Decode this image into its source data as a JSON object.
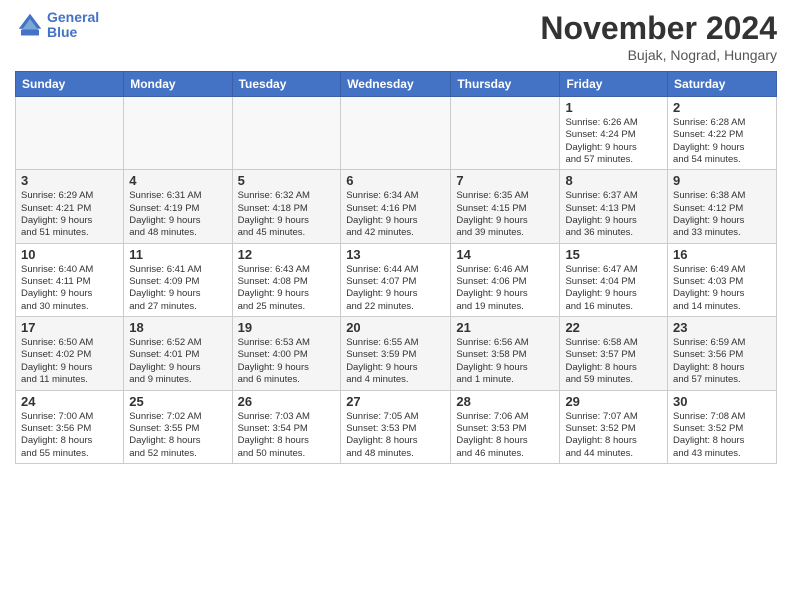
{
  "logo": {
    "line1": "General",
    "line2": "Blue"
  },
  "title": "November 2024",
  "location": "Bujak, Nograd, Hungary",
  "days_of_week": [
    "Sunday",
    "Monday",
    "Tuesday",
    "Wednesday",
    "Thursday",
    "Friday",
    "Saturday"
  ],
  "weeks": [
    {
      "shaded": false,
      "days": [
        {
          "num": "",
          "info": "",
          "empty": true
        },
        {
          "num": "",
          "info": "",
          "empty": true
        },
        {
          "num": "",
          "info": "",
          "empty": true
        },
        {
          "num": "",
          "info": "",
          "empty": true
        },
        {
          "num": "",
          "info": "",
          "empty": true
        },
        {
          "num": "1",
          "info": "Sunrise: 6:26 AM\nSunset: 4:24 PM\nDaylight: 9 hours\nand 57 minutes.",
          "empty": false
        },
        {
          "num": "2",
          "info": "Sunrise: 6:28 AM\nSunset: 4:22 PM\nDaylight: 9 hours\nand 54 minutes.",
          "empty": false
        }
      ]
    },
    {
      "shaded": true,
      "days": [
        {
          "num": "3",
          "info": "Sunrise: 6:29 AM\nSunset: 4:21 PM\nDaylight: 9 hours\nand 51 minutes.",
          "empty": false
        },
        {
          "num": "4",
          "info": "Sunrise: 6:31 AM\nSunset: 4:19 PM\nDaylight: 9 hours\nand 48 minutes.",
          "empty": false
        },
        {
          "num": "5",
          "info": "Sunrise: 6:32 AM\nSunset: 4:18 PM\nDaylight: 9 hours\nand 45 minutes.",
          "empty": false
        },
        {
          "num": "6",
          "info": "Sunrise: 6:34 AM\nSunset: 4:16 PM\nDaylight: 9 hours\nand 42 minutes.",
          "empty": false
        },
        {
          "num": "7",
          "info": "Sunrise: 6:35 AM\nSunset: 4:15 PM\nDaylight: 9 hours\nand 39 minutes.",
          "empty": false
        },
        {
          "num": "8",
          "info": "Sunrise: 6:37 AM\nSunset: 4:13 PM\nDaylight: 9 hours\nand 36 minutes.",
          "empty": false
        },
        {
          "num": "9",
          "info": "Sunrise: 6:38 AM\nSunset: 4:12 PM\nDaylight: 9 hours\nand 33 minutes.",
          "empty": false
        }
      ]
    },
    {
      "shaded": false,
      "days": [
        {
          "num": "10",
          "info": "Sunrise: 6:40 AM\nSunset: 4:11 PM\nDaylight: 9 hours\nand 30 minutes.",
          "empty": false
        },
        {
          "num": "11",
          "info": "Sunrise: 6:41 AM\nSunset: 4:09 PM\nDaylight: 9 hours\nand 27 minutes.",
          "empty": false
        },
        {
          "num": "12",
          "info": "Sunrise: 6:43 AM\nSunset: 4:08 PM\nDaylight: 9 hours\nand 25 minutes.",
          "empty": false
        },
        {
          "num": "13",
          "info": "Sunrise: 6:44 AM\nSunset: 4:07 PM\nDaylight: 9 hours\nand 22 minutes.",
          "empty": false
        },
        {
          "num": "14",
          "info": "Sunrise: 6:46 AM\nSunset: 4:06 PM\nDaylight: 9 hours\nand 19 minutes.",
          "empty": false
        },
        {
          "num": "15",
          "info": "Sunrise: 6:47 AM\nSunset: 4:04 PM\nDaylight: 9 hours\nand 16 minutes.",
          "empty": false
        },
        {
          "num": "16",
          "info": "Sunrise: 6:49 AM\nSunset: 4:03 PM\nDaylight: 9 hours\nand 14 minutes.",
          "empty": false
        }
      ]
    },
    {
      "shaded": true,
      "days": [
        {
          "num": "17",
          "info": "Sunrise: 6:50 AM\nSunset: 4:02 PM\nDaylight: 9 hours\nand 11 minutes.",
          "empty": false
        },
        {
          "num": "18",
          "info": "Sunrise: 6:52 AM\nSunset: 4:01 PM\nDaylight: 9 hours\nand 9 minutes.",
          "empty": false
        },
        {
          "num": "19",
          "info": "Sunrise: 6:53 AM\nSunset: 4:00 PM\nDaylight: 9 hours\nand 6 minutes.",
          "empty": false
        },
        {
          "num": "20",
          "info": "Sunrise: 6:55 AM\nSunset: 3:59 PM\nDaylight: 9 hours\nand 4 minutes.",
          "empty": false
        },
        {
          "num": "21",
          "info": "Sunrise: 6:56 AM\nSunset: 3:58 PM\nDaylight: 9 hours\nand 1 minute.",
          "empty": false
        },
        {
          "num": "22",
          "info": "Sunrise: 6:58 AM\nSunset: 3:57 PM\nDaylight: 8 hours\nand 59 minutes.",
          "empty": false
        },
        {
          "num": "23",
          "info": "Sunrise: 6:59 AM\nSunset: 3:56 PM\nDaylight: 8 hours\nand 57 minutes.",
          "empty": false
        }
      ]
    },
    {
      "shaded": false,
      "days": [
        {
          "num": "24",
          "info": "Sunrise: 7:00 AM\nSunset: 3:56 PM\nDaylight: 8 hours\nand 55 minutes.",
          "empty": false
        },
        {
          "num": "25",
          "info": "Sunrise: 7:02 AM\nSunset: 3:55 PM\nDaylight: 8 hours\nand 52 minutes.",
          "empty": false
        },
        {
          "num": "26",
          "info": "Sunrise: 7:03 AM\nSunset: 3:54 PM\nDaylight: 8 hours\nand 50 minutes.",
          "empty": false
        },
        {
          "num": "27",
          "info": "Sunrise: 7:05 AM\nSunset: 3:53 PM\nDaylight: 8 hours\nand 48 minutes.",
          "empty": false
        },
        {
          "num": "28",
          "info": "Sunrise: 7:06 AM\nSunset: 3:53 PM\nDaylight: 8 hours\nand 46 minutes.",
          "empty": false
        },
        {
          "num": "29",
          "info": "Sunrise: 7:07 AM\nSunset: 3:52 PM\nDaylight: 8 hours\nand 44 minutes.",
          "empty": false
        },
        {
          "num": "30",
          "info": "Sunrise: 7:08 AM\nSunset: 3:52 PM\nDaylight: 8 hours\nand 43 minutes.",
          "empty": false
        }
      ]
    }
  ]
}
